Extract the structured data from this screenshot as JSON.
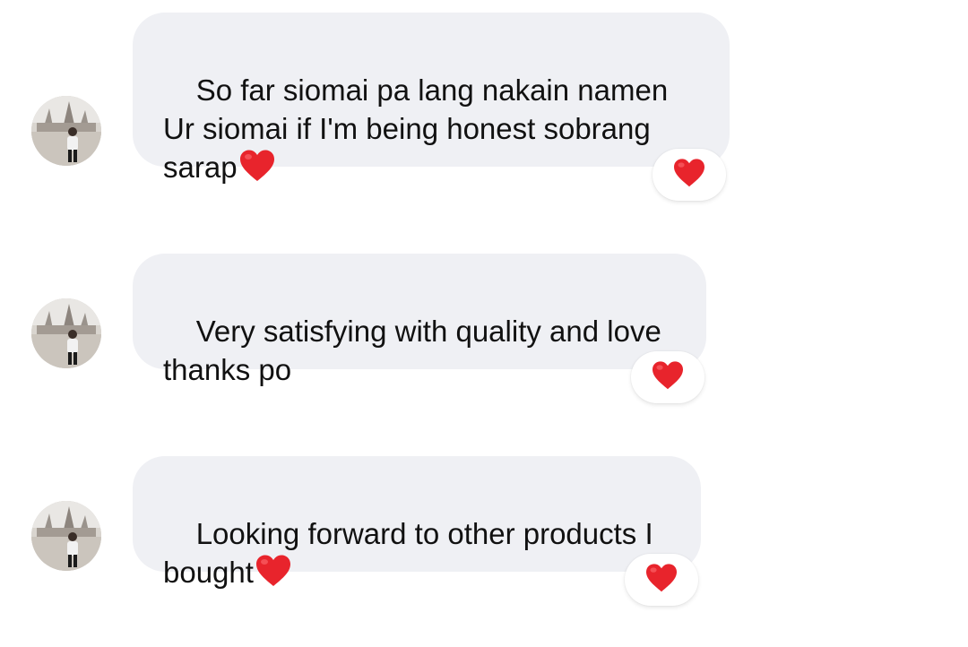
{
  "conversation": {
    "messages": [
      {
        "lines": [
          "So far siomai pa lang nakain namen",
          "Ur siomai if I'm being honest sobrang",
          "sarap"
        ],
        "trailing_emoji": "red-heart",
        "reaction": "red-heart"
      },
      {
        "lines": [
          "Very satisfying with quality and love",
          "thanks po"
        ],
        "trailing_emoji": null,
        "reaction": "red-heart"
      },
      {
        "lines": [
          "Looking forward to other products I",
          "bought"
        ],
        "trailing_emoji": "red-heart",
        "reaction": "red-heart"
      }
    ]
  },
  "colors": {
    "bubble_bg": "#eff0f4",
    "text": "#111111",
    "heart": "#e8242c",
    "reaction_bg": "#ffffff"
  }
}
